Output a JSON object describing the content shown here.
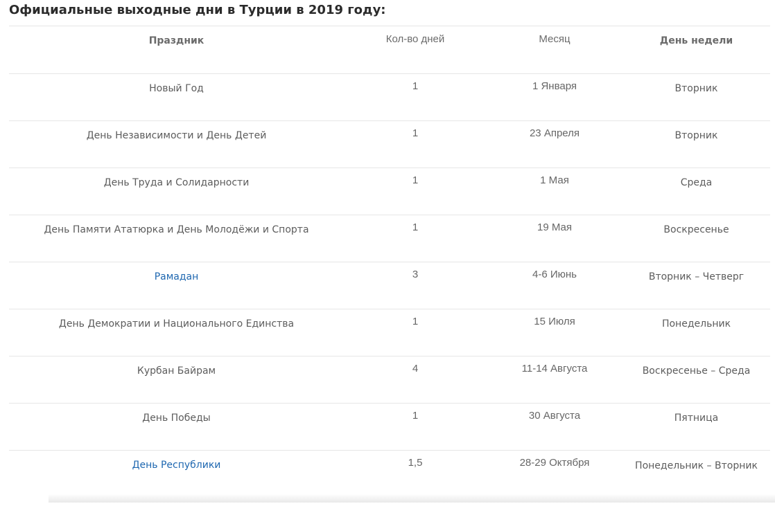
{
  "page": {
    "title": "Официальные выходные дни в Турции в 2019 году:"
  },
  "table": {
    "headers": {
      "holiday": "Праздник",
      "days": "Кол-во дней",
      "month": "Месяц",
      "weekday": "День недели"
    },
    "rows": [
      {
        "holiday": "Новый Год",
        "days": "1",
        "date": "1 Января",
        "weekday": "Вторник",
        "is_link": false
      },
      {
        "holiday": "День Независимости и День Детей",
        "days": "1",
        "date": "23 Апреля",
        "weekday": "Вторник",
        "is_link": false
      },
      {
        "holiday": "День Труда и Солидарности",
        "days": "1",
        "date": "1 Мая",
        "weekday": "Среда",
        "is_link": false
      },
      {
        "holiday": "День Памяти Ататюрка и День Молодёжи и Спорта",
        "days": "1",
        "date": "19 Мая",
        "weekday": "Воскресенье",
        "is_link": false
      },
      {
        "holiday": "Рамадан",
        "days": "3",
        "date": "4-6 Июнь",
        "weekday": "Вторник – Четверг",
        "is_link": true
      },
      {
        "holiday": "День Демократии и Национального Единства",
        "days": "1",
        "date": "15 Июля",
        "weekday": "Понедельник",
        "is_link": false
      },
      {
        "holiday": "Курбан Байрам",
        "days": "4",
        "date": "11-14 Августа",
        "weekday": "Воскресенье – Среда",
        "is_link": false
      },
      {
        "holiday": "День Победы",
        "days": "1",
        "date": "30 Августа",
        "weekday": "Пятница",
        "is_link": false
      },
      {
        "holiday": "День Республики",
        "days": "1,5",
        "date": "28-29 Октября",
        "weekday": "Понедельник – Вторник",
        "is_link": true
      }
    ]
  },
  "colors": {
    "link": "#1e67b0",
    "text": "#5c5c5c",
    "title": "#2b2b2b",
    "border": "#e6e6e6"
  }
}
